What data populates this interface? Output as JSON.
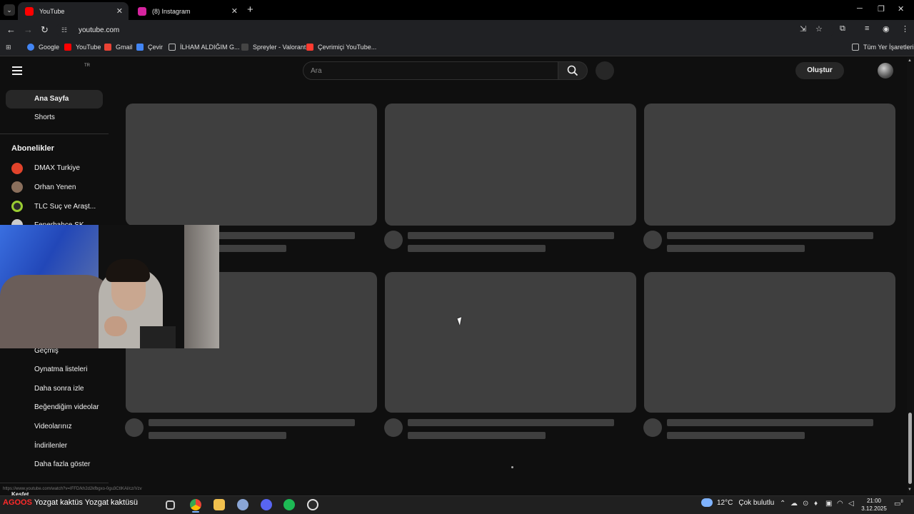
{
  "browser": {
    "tabs": [
      {
        "label": "YouTube",
        "active": true,
        "favicon_color": "#ff0000"
      },
      {
        "label": "(8) Instagram",
        "active": false,
        "favicon_color": "#d6249f"
      }
    ],
    "new_tab_icon": "plus-icon",
    "url": "youtube.com",
    "bookmarks": [
      {
        "label": "Google",
        "color": "#4285f4"
      },
      {
        "label": "YouTube",
        "color": "#ff0000"
      },
      {
        "label": "Gmail",
        "color": "#ea4335"
      },
      {
        "label": "Çevir",
        "color": "#4285f4"
      },
      {
        "label": "İLHAM ALDIĞIM G...",
        "color": "#bbbbbb"
      },
      {
        "label": "Spreyler - Valorant",
        "color": "#ffffff"
      },
      {
        "label": "Çevrimiçi YouTube...",
        "color": "#ff3b30"
      }
    ],
    "all_bookmarks": "Tüm Yer İşaretleri"
  },
  "youtube": {
    "country_code": "TR",
    "search_placeholder": "Ara",
    "create_label": "Oluştur",
    "sidebar": {
      "top_items": [
        "Ana Sayfa",
        "Shorts"
      ],
      "subscriptions_title": "Abonelikler",
      "subscriptions": [
        {
          "name": "DMAX Turkiye",
          "color": "#e1432b"
        },
        {
          "name": "Orhan Yenen",
          "color": "#8a6f5c"
        },
        {
          "name": "TLC Suç ve Araşt...",
          "color": "#9acd32"
        },
        {
          "name": "Fenerbahçe SK",
          "color": "#cccccc"
        }
      ],
      "you_items": [
        "Geçmiş",
        "Oynatma listeleri",
        "Daha sonra izle",
        "Beğendiğim videolar",
        "Videolarınız",
        "İndirilenler",
        "Daha fazla göster"
      ],
      "explore_title": "Keşfet"
    }
  },
  "status_url": "https://www.youtube.com/watch?v=IFFD/kh2d2kfbgxo-0gu3CtIKAl/cz/Vzv",
  "stream_overlay": {
    "prefix": "AGOOS",
    "text": "Yozgat kaktüs Yozgat kaktüsü"
  },
  "taskbar": {
    "apps": [
      {
        "name": "task-view-icon",
        "color": "#cccccc"
      },
      {
        "name": "chrome-icon",
        "color": "#fbbc05"
      },
      {
        "name": "file-explorer-icon",
        "color": "#f2c14e"
      },
      {
        "name": "riot-client-icon",
        "color": "#8aa6d6"
      },
      {
        "name": "discord-icon",
        "color": "#5865f2"
      },
      {
        "name": "spotify-icon",
        "color": "#1db954"
      },
      {
        "name": "obs-icon",
        "color": "#e0e0e0"
      }
    ],
    "weather_temp": "12°C",
    "weather_desc": "Çok bulutlu",
    "time": "21:00",
    "date": "3.12.2025",
    "notification_count": "8"
  }
}
